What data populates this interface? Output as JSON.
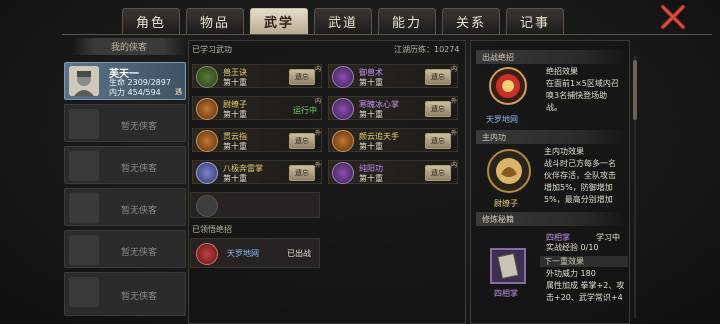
{
  "tabs": [
    {
      "label": "角色",
      "active": false
    },
    {
      "label": "物品",
      "active": false
    },
    {
      "label": "武学",
      "active": true
    },
    {
      "label": "武道",
      "active": false
    },
    {
      "label": "能力",
      "active": false
    },
    {
      "label": "关系",
      "active": false
    },
    {
      "label": "记事",
      "active": false
    }
  ],
  "left": {
    "header": "我的侠客",
    "hero": {
      "name": "芙天一",
      "hp": "生命 2309/2897",
      "mp": "内力 454/594",
      "tag": "遇"
    },
    "empty_label": "暂无侠客"
  },
  "middle": {
    "learned_title": "已学习武功",
    "experience": "江湖历练：10274",
    "level": "第十重",
    "forget": "遗忘",
    "running": "运行中",
    "flag_inner": "内",
    "flag_outer": "外",
    "skills": [
      {
        "name": "兽王诀",
        "color": "#e8d36a"
      },
      {
        "name": "御兽术",
        "color": "#c892f0"
      },
      {
        "name": "尉缭子",
        "color": "#e8d36a"
      },
      {
        "name": "寒魄冰心掌",
        "color": "#c892f0"
      },
      {
        "name": "贯云指",
        "color": "#e8d36a"
      },
      {
        "name": "颜云追天手",
        "color": "#e8d36a"
      },
      {
        "name": "八极奔雷掌",
        "color": "#e8d36a"
      },
      {
        "name": "纯阳功",
        "color": "#c892f0"
      }
    ],
    "unique_title": "已领悟绝招",
    "unique": {
      "name": "天罗地网",
      "status": "已出战"
    }
  },
  "right": {
    "battle_head": "出战绝招",
    "battle_effect_title": "绝招效果",
    "battle_effect_text": [
      "在面前1×5区域内召",
      "唤3名捕快登场助",
      "战。"
    ],
    "battle_name": "天罗地网",
    "internal_head": "主内功",
    "internal_effect_title": "主内功效果",
    "internal_effect_text": [
      "战斗时己方每多一名",
      "伙伴存活，全队攻击",
      "增加5%，防御增加",
      "5%，最高分别增加"
    ],
    "internal_name": "尉缭子",
    "train_head": "修炼秘籍",
    "train_name": "四相掌",
    "train_status": "学习中",
    "train_exp": "实战经验 0/10",
    "train_next": "下一重效果",
    "train_lines": [
      "外功威力 180",
      "属性加成 拳掌+2、攻",
      "击+20、武学常识+4"
    ],
    "train_book": "四相掌"
  },
  "colors": {
    "accent": "#e6dccb",
    "running": "#6fd06f",
    "purple_name": "#c892f0",
    "gold_name": "#e8d36a",
    "unique_name": "#8fb7e8"
  }
}
